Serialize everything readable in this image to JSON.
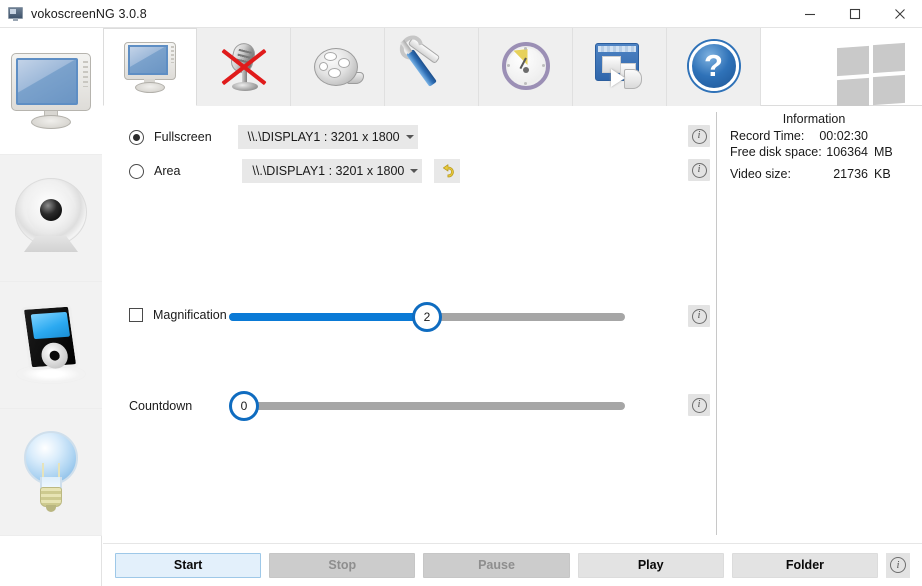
{
  "window": {
    "title": "vokoscreenNG 3.0.8",
    "app_icon": "monitor-icon",
    "controls": {
      "minimize": "minimize-icon",
      "maximize": "maximize-icon",
      "close": "close-icon"
    }
  },
  "sidebar": {
    "items": [
      {
        "name": "screen",
        "icon": "monitor-icon",
        "selected": true
      },
      {
        "name": "webcam",
        "icon": "webcam-icon",
        "selected": false
      },
      {
        "name": "player",
        "icon": "media-player-icon",
        "selected": false
      },
      {
        "name": "about",
        "icon": "lightbulb-icon",
        "selected": false
      }
    ]
  },
  "toolbar": {
    "tabs": [
      {
        "name": "screen",
        "icon": "monitor-icon",
        "selected": true
      },
      {
        "name": "audio",
        "icon": "microphone-muted-icon",
        "selected": false
      },
      {
        "name": "video",
        "icon": "film-reel-icon",
        "selected": false
      },
      {
        "name": "settings",
        "icon": "tools-icon",
        "selected": false
      },
      {
        "name": "timer",
        "icon": "clock-icon",
        "selected": false
      },
      {
        "name": "export",
        "icon": "window-export-icon",
        "selected": false
      },
      {
        "name": "help",
        "icon": "help-question-icon",
        "selected": false
      }
    ],
    "logo": "windows-logo-icon"
  },
  "main": {
    "fullscreen": {
      "label": "Fullscreen",
      "selected": true,
      "display_value": "\\\\.\\DISPLAY1 :  3201 x 1800",
      "info_icon": "info-icon"
    },
    "area": {
      "label": "Area",
      "selected": false,
      "display_value": "\\\\.\\DISPLAY1 :  3201 x 1800",
      "reset_icon": "undo-arrow-icon",
      "info_icon": "info-icon"
    },
    "magnification": {
      "label": "Magnification",
      "checked": false,
      "value": "2",
      "min": 0,
      "max": 4,
      "percent": 50,
      "info_icon": "info-icon"
    },
    "countdown": {
      "label": "Countdown",
      "value": "0",
      "min": 0,
      "max": 60,
      "percent": 0,
      "info_icon": "info-icon"
    }
  },
  "information": {
    "title": "Information",
    "rows": [
      {
        "key": "Record Time:",
        "value": "00:02:30",
        "unit": ""
      },
      {
        "key": "Free disk space:",
        "value": "106364",
        "unit": "MB"
      },
      {
        "key": "Video size:",
        "value": "21736",
        "unit": "KB"
      }
    ]
  },
  "bottom": {
    "buttons": [
      {
        "label": "Start",
        "state": "primary"
      },
      {
        "label": "Stop",
        "state": "disabled"
      },
      {
        "label": "Pause",
        "state": "disabled"
      },
      {
        "label": "Play",
        "state": "normal"
      },
      {
        "label": "Folder",
        "state": "normal"
      }
    ],
    "info_icon": "info-icon"
  },
  "colors": {
    "accent_blue": "#0a7ad6",
    "handle_ring": "#0f6cc0",
    "track_gray": "#a6a6a6",
    "primary_button_bg": "#e3f0fb",
    "mic_mute_red": "#e01b1b"
  }
}
